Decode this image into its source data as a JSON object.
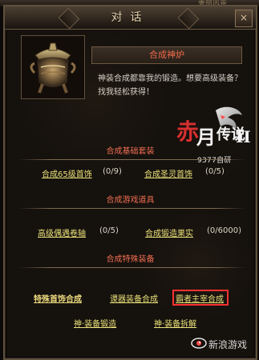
{
  "header": {
    "top_right_label": "美丽风景",
    "title": "对话",
    "close_icon": "close-icon"
  },
  "npc": {
    "name": "合成神炉",
    "intro": "神装合成都靠我的锻造。想要高级装备？找我轻松获得！",
    "portrait_icon": "cauldron-icon"
  },
  "logo": {
    "caption": "9377自研",
    "logo_icon": "game-logo-icon"
  },
  "sections": [
    {
      "title": "合成基础套装"
    },
    {
      "title": "合成游戏道具"
    },
    {
      "title": "合成特殊装备"
    }
  ],
  "basic_set": [
    {
      "label": "合成65级首饰",
      "count": "(0/9)"
    },
    {
      "label": "合成圣灵首饰",
      "count": "(0/5)"
    }
  ],
  "game_items": [
    {
      "label": "高级偶遇卷轴",
      "count": "(0/5)"
    },
    {
      "label": "合成锻造果实",
      "count": "(0/6000)"
    }
  ],
  "special": {
    "heading": "特殊首饰合成",
    "links": [
      "谡器装备合成",
      "霸者主宰合成",
      "神·装备锻造",
      "神·装备拆解"
    ]
  },
  "watermark": {
    "text": "新浪游戏",
    "icon": "sina-eye-icon"
  }
}
